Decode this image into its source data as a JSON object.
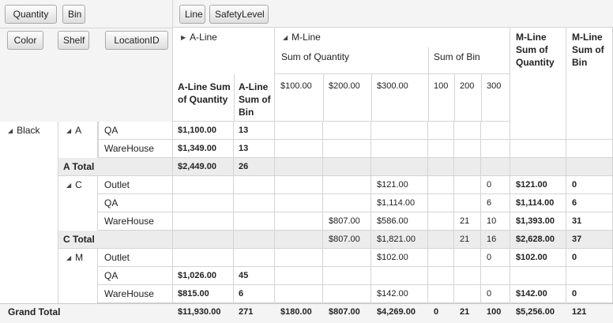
{
  "fields": {
    "filter": [
      "Quantity",
      "Bin"
    ],
    "column": [
      "Line",
      "SafetyLevel"
    ],
    "row": [
      "Color",
      "Shelf",
      "LocationID"
    ]
  },
  "columns": {
    "a_line": {
      "label": "A-Line",
      "sum_quantity": "A-Line Sum of Quantity",
      "sum_bin": "A-Line Sum of Bin"
    },
    "m_line": {
      "label": "M-Line",
      "sum_quantity_group": "Sum of Quantity",
      "sum_bin_group": "Sum of Bin",
      "qty_levels": [
        "$100.00",
        "$200.00",
        "$300.00"
      ],
      "bin_levels": [
        "100",
        "200",
        "300"
      ],
      "total_quantity": "M-Line Sum of Quantity",
      "total_bin": "M-Line Sum of Bin"
    }
  },
  "rows": [
    {
      "color": "Black",
      "shelf": "A",
      "loc": "QA",
      "a_qty": "$1,100.00",
      "a_bin": "13",
      "m100": "",
      "m200": "",
      "m300": "",
      "b100": "",
      "b200": "",
      "b300": "",
      "m_qty": "",
      "m_bin": ""
    },
    {
      "color": "",
      "shelf": "",
      "loc": "WareHouse",
      "a_qty": "$1,349.00",
      "a_bin": "13",
      "m100": "",
      "m200": "",
      "m300": "",
      "b100": "",
      "b200": "",
      "b300": "",
      "m_qty": "",
      "m_bin": ""
    },
    {
      "total": "A Total",
      "a_qty": "$2,449.00",
      "a_bin": "26",
      "m100": "",
      "m200": "",
      "m300": "",
      "b100": "",
      "b200": "",
      "b300": "",
      "m_qty": "",
      "m_bin": ""
    },
    {
      "color": "",
      "shelf": "C",
      "loc": "Outlet",
      "a_qty": "",
      "a_bin": "",
      "m100": "",
      "m200": "",
      "m300": "$121.00",
      "b100": "",
      "b200": "",
      "b300": "0",
      "m_qty": "$121.00",
      "m_bin": "0"
    },
    {
      "color": "",
      "shelf": "",
      "loc": "QA",
      "a_qty": "",
      "a_bin": "",
      "m100": "",
      "m200": "",
      "m300": "$1,114.00",
      "b100": "",
      "b200": "",
      "b300": "6",
      "m_qty": "$1,114.00",
      "m_bin": "6"
    },
    {
      "color": "",
      "shelf": "",
      "loc": "WareHouse",
      "a_qty": "",
      "a_bin": "",
      "m100": "",
      "m200": "$807.00",
      "m300": "$586.00",
      "b100": "",
      "b200": "21",
      "b300": "10",
      "m_qty": "$1,393.00",
      "m_bin": "31"
    },
    {
      "total": "C Total",
      "a_qty": "",
      "a_bin": "",
      "m100": "",
      "m200": "$807.00",
      "m300": "$1,821.00",
      "b100": "",
      "b200": "21",
      "b300": "16",
      "m_qty": "$2,628.00",
      "m_bin": "37"
    },
    {
      "color": "",
      "shelf": "M",
      "loc": "Outlet",
      "a_qty": "",
      "a_bin": "",
      "m100": "",
      "m200": "",
      "m300": "$102.00",
      "b100": "",
      "b200": "",
      "b300": "0",
      "m_qty": "$102.00",
      "m_bin": "0"
    },
    {
      "color": "",
      "shelf": "",
      "loc": "QA",
      "a_qty": "$1,026.00",
      "a_bin": "45",
      "m100": "",
      "m200": "",
      "m300": "",
      "b100": "",
      "b200": "",
      "b300": "",
      "m_qty": "",
      "m_bin": ""
    },
    {
      "color": "",
      "shelf": "",
      "loc": "WareHouse",
      "a_qty": "$815.00",
      "a_bin": "6",
      "m100": "",
      "m200": "",
      "m300": "$142.00",
      "b100": "",
      "b200": "",
      "b300": "0",
      "m_qty": "$142.00",
      "m_bin": "0"
    }
  ],
  "grand_total": {
    "label": "Grand Total",
    "a_qty": "$11,930.00",
    "a_bin": "271",
    "m100": "$180.00",
    "m200": "$807.00",
    "m300": "$4,269.00",
    "b100": "0",
    "b200": "21",
    "b300": "100",
    "m_qty": "$5,256.00",
    "m_bin": "121"
  },
  "icons": {
    "collapse": "triangle-down-icon",
    "expand": "triangle-right-icon"
  },
  "colors": {
    "header_bg": "#f4f4f4",
    "total_bg": "#ececec",
    "grid": "#d4d4d4"
  }
}
